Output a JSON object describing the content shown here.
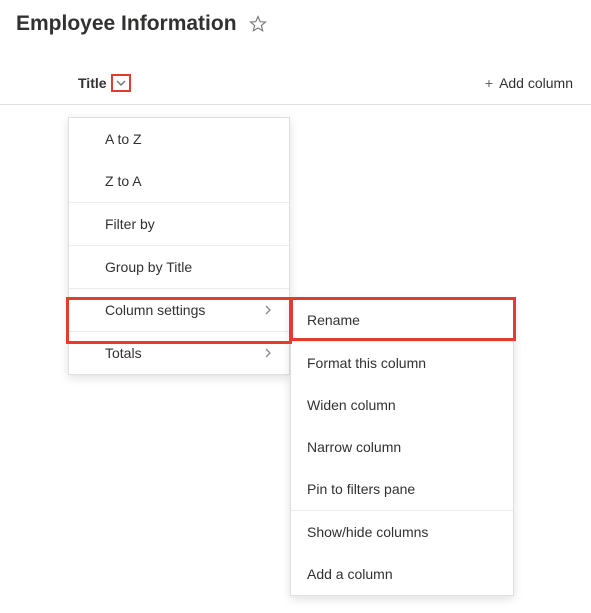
{
  "page": {
    "title": "Employee Information"
  },
  "columns": {
    "title_label": "Title",
    "add_column_label": "Add column"
  },
  "menu_primary": {
    "sort_az": "A to Z",
    "sort_za": "Z to A",
    "filter_by": "Filter by",
    "group_by": "Group by Title",
    "column_settings": "Column settings",
    "totals": "Totals"
  },
  "menu_secondary": {
    "rename": "Rename",
    "format": "Format this column",
    "widen": "Widen column",
    "narrow": "Narrow column",
    "pin": "Pin to filters pane",
    "showhide": "Show/hide columns",
    "add": "Add a column"
  }
}
